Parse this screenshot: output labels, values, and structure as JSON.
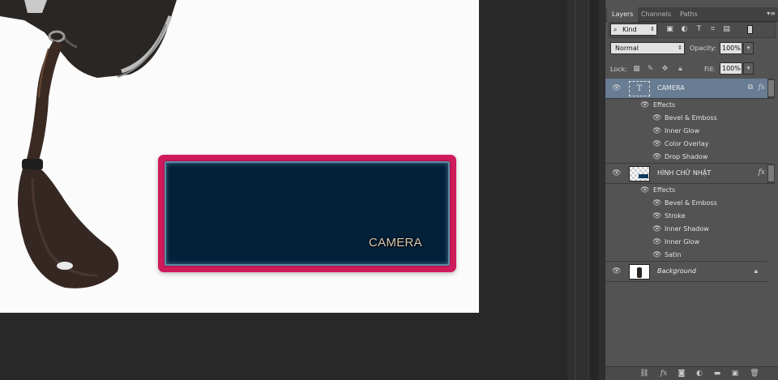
{
  "canvas": {
    "plate_text": "CAMERA",
    "colors": {
      "plate_border": "#cf1a5c",
      "plate_fill": "#04213a"
    }
  },
  "layers_panel": {
    "tabs": [
      "Layers",
      "Channels",
      "Paths"
    ],
    "filter": {
      "kind_label": "Kind",
      "icons": [
        "image-filter-icon",
        "adjustment-filter-icon",
        "type-filter-icon",
        "shape-filter-icon",
        "smart-object-filter-icon",
        "filter-toggle-icon"
      ]
    },
    "blend_mode": "Normal",
    "opacity_label": "Opacity:",
    "opacity_value": "100%",
    "lock_label": "Lock:",
    "fill_label": "Fill:",
    "fill_value": "100%",
    "layers": [
      {
        "name": "CAMERA",
        "effects_label": "Effects",
        "effects": [
          "Bevel & Emboss",
          "Inner Glow",
          "Color Overlay",
          "Drop Shadow"
        ]
      },
      {
        "name": "HÌNH CHỮ NHẬT",
        "effects_label": "Effects",
        "effects": [
          "Bevel & Emboss",
          "Stroke",
          "Inner Shadow",
          "Inner Glow",
          "Satin"
        ]
      },
      {
        "name": "Background"
      }
    ],
    "fx_label": "fx",
    "footer_icons": [
      "link-layers-icon",
      "add-style-icon",
      "add-mask-icon",
      "adjustment-layer-icon",
      "new-group-icon",
      "new-layer-icon",
      "delete-layer-icon"
    ]
  }
}
